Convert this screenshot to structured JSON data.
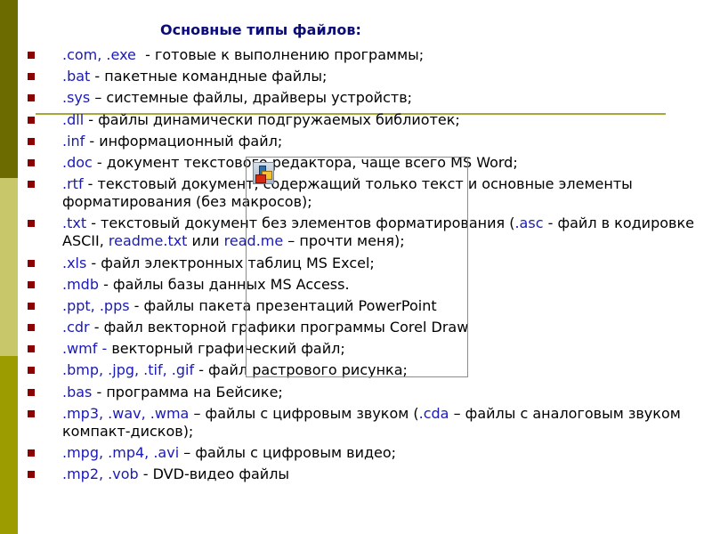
{
  "colors": {
    "title": "#0b0b7a",
    "extension": "#1a1ab8",
    "bullet": "#8b0000",
    "sidebar_top": "#6b6b00",
    "sidebar_middle": "#c8c86a",
    "sidebar_bottom": "#9c9c00",
    "rule": "#a8a838"
  },
  "title": "Основные типы файлов:",
  "items": [
    {
      "ext": ".com, .exe",
      "text": "  - готовые к выполнению программы;"
    },
    {
      "ext": ".bat",
      "text": " - пакетные командные файлы;"
    },
    {
      "ext": ".sys",
      "text": " – системные файлы, драйверы устройств;"
    },
    {
      "ext": ".dll",
      "text": " - файлы динамически подгружаемых библиотек;"
    },
    {
      "ext": ".inf",
      "text": " - информационный файл;"
    },
    {
      "ext": ".doc",
      "text": " - документ текстового редактора, чаще всего MS Word;"
    },
    {
      "ext": ".rtf",
      "text": "  - текстовый документ, содержащий только текст и основные элементы форматирования (без макросов);"
    },
    {
      "ext": ".txt",
      "text": " - текстовый документ без элементов форматирования (",
      "ext2": ".asc",
      "text2": " - файл в кодировке ASCII, ",
      "ext3": "readme.txt",
      "text3": " или ",
      "ext4": "read.me",
      "text4": " – прочти меня);"
    },
    {
      "ext": ".xls",
      "text": " - файл электронных таблиц MS Excel;"
    },
    {
      "ext": ".mdb",
      "text": " - файлы базы данных MS Access."
    },
    {
      "ext": ".ppt, .pps",
      "text": " - файлы пакета презентаций PowerPoint"
    },
    {
      "ext": ".cdr",
      "text": " - файл векторной графики программы Corel Draw"
    },
    {
      "ext": ".wmf -",
      "text": " векторный графический файл;"
    },
    {
      "ext": ".bmp, .jpg, .tif, .gif",
      "text": " - файл растрового рисунка;"
    },
    {
      "ext": ".bas",
      "text": " - программа на Бейсике;"
    },
    {
      "ext": ".mp3, .wav, .wma",
      "text": " – файлы с цифровым звуком (",
      "ext2": ".cda",
      "text2": " – файлы с аналоговым звуком компакт-дисков);"
    },
    {
      "ext": ".mpg, .mp4, .avi",
      "text": " – файлы с цифровым видео;"
    },
    {
      "ext": ".mp2, .vob",
      "text": "  - DVD-видео файлы"
    }
  ],
  "embedded_object": {
    "icon": "embedded-object-icon"
  }
}
